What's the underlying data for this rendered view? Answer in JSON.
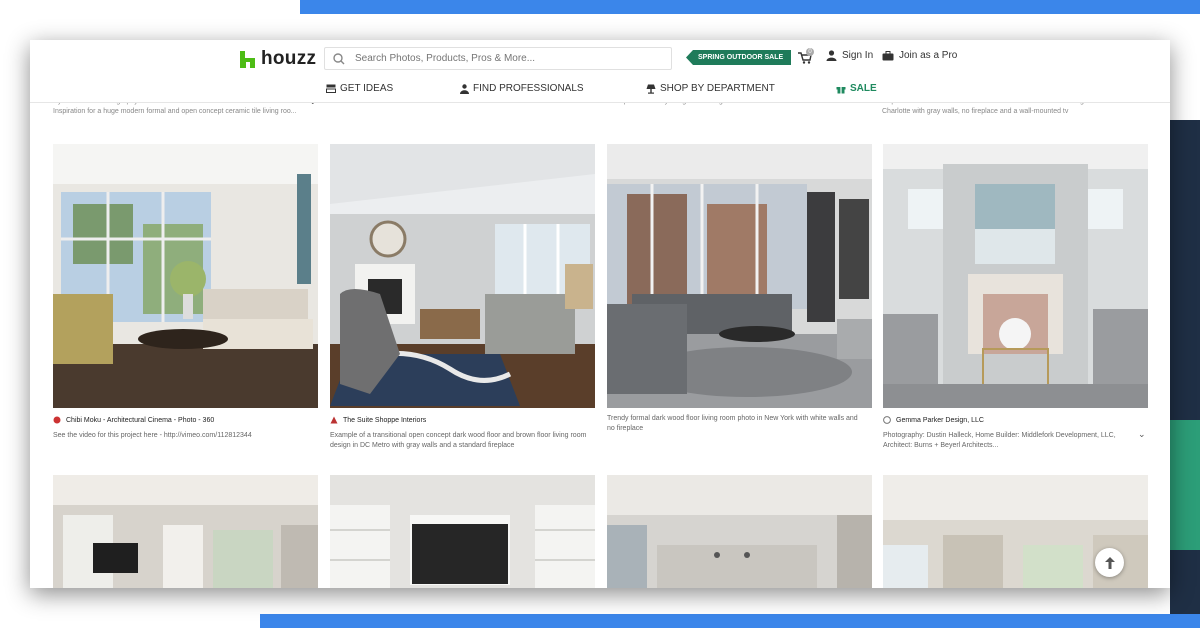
{
  "brand": {
    "name": "houzz"
  },
  "search": {
    "placeholder": "Search Photos, Products, Pros & More..."
  },
  "promo": {
    "label": "SPRING OUTDOOR SALE"
  },
  "cart": {
    "count": "0"
  },
  "account": {
    "sign_in": "Sign In",
    "join_pro": "Join as a Pro"
  },
  "nav": [
    {
      "label": "GET IDEAS"
    },
    {
      "label": "FIND PROFESSIONALS"
    },
    {
      "label": "SHOP BY DEPARTMENT"
    },
    {
      "label": "SALE"
    }
  ],
  "previous_row": [
    {
      "credit": "Ryan Gamma Photography",
      "desc": "Inspiration for a huge modern formal and open concept ceramic tile living roo..."
    },
    {
      "credit": "",
      "desc": "Example of a trendy living room design in Little Rock"
    },
    {
      "credit": "",
      "desc": "Inspiration for a transitional dark wood floor and brown floor living room remodel in Charlotte with gray walls, no fireplace and a wall-mounted tv"
    }
  ],
  "cards": [
    {
      "credit": "Chibi Moku - Architectural Cinema - Photo - 360",
      "desc": "See the video for this project here - http://vimeo.com/112812344"
    },
    {
      "credit": "The Suite Shoppe Interiors",
      "desc": "Example of a transitional open concept dark wood floor and brown floor living room design in DC Metro with gray walls and a standard fireplace"
    },
    {
      "credit": "",
      "desc": "Trendy formal dark wood floor living room photo in New York with white walls and no fireplace"
    },
    {
      "credit": "Gemma Parker Design, LLC",
      "desc": "Photography: Dustin Halleck, Home Builder: Middlefork Development, LLC, Architect: Burns + Beyerl Architects..."
    }
  ],
  "colors": {
    "brand_green": "#4dbc15",
    "sale_green": "#1f7b5a",
    "accent_blue": "#3b86ea"
  }
}
